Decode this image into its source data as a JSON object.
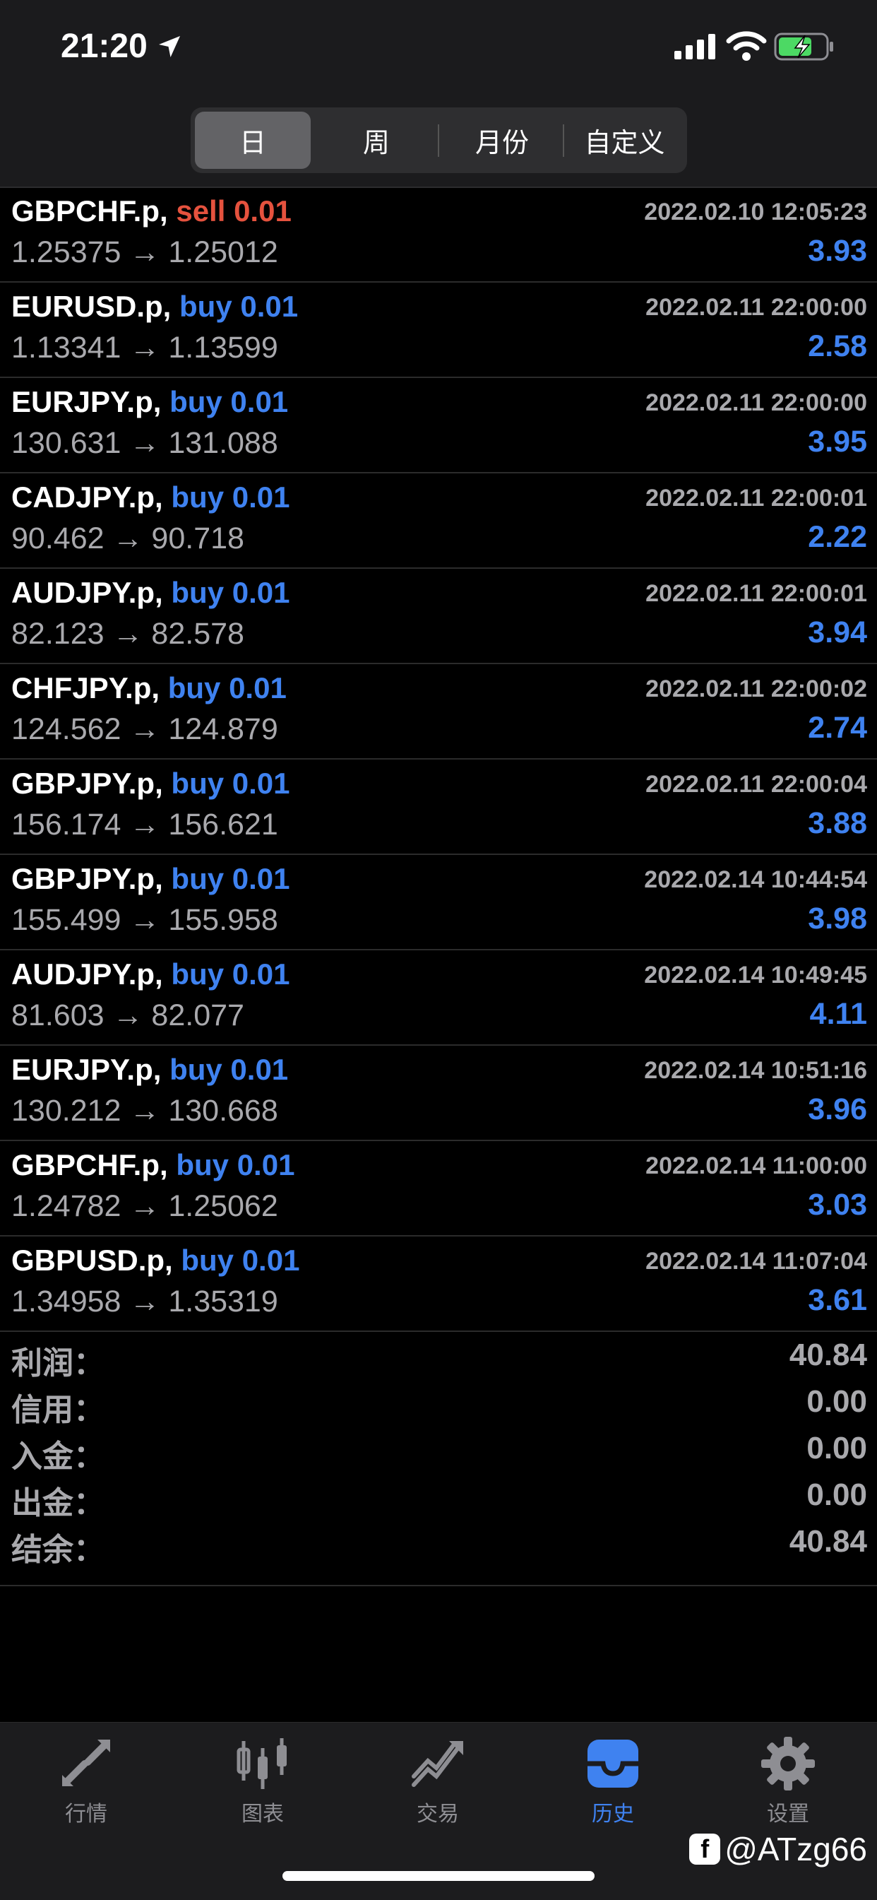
{
  "status": {
    "time": "21:20"
  },
  "segments": [
    {
      "label": "日",
      "active": true
    },
    {
      "label": "周",
      "active": false
    },
    {
      "label": "月份",
      "active": false
    },
    {
      "label": "自定义",
      "active": false
    }
  ],
  "trades": [
    {
      "symbol": "GBPCHF.p,",
      "side": "sell",
      "volume": "0.01",
      "time": "2022.02.10 12:05:23",
      "prices": "1.25375 → 1.25012",
      "profit": "3.93"
    },
    {
      "symbol": "EURUSD.p,",
      "side": "buy",
      "volume": "0.01",
      "time": "2022.02.11 22:00:00",
      "prices": "1.13341 → 1.13599",
      "profit": "2.58"
    },
    {
      "symbol": "EURJPY.p,",
      "side": "buy",
      "volume": "0.01",
      "time": "2022.02.11 22:00:00",
      "prices": "130.631 → 131.088",
      "profit": "3.95"
    },
    {
      "symbol": "CADJPY.p,",
      "side": "buy",
      "volume": "0.01",
      "time": "2022.02.11 22:00:01",
      "prices": "90.462 → 90.718",
      "profit": "2.22"
    },
    {
      "symbol": "AUDJPY.p,",
      "side": "buy",
      "volume": "0.01",
      "time": "2022.02.11 22:00:01",
      "prices": "82.123 → 82.578",
      "profit": "3.94"
    },
    {
      "symbol": "CHFJPY.p,",
      "side": "buy",
      "volume": "0.01",
      "time": "2022.02.11 22:00:02",
      "prices": "124.562 → 124.879",
      "profit": "2.74"
    },
    {
      "symbol": "GBPJPY.p,",
      "side": "buy",
      "volume": "0.01",
      "time": "2022.02.11 22:00:04",
      "prices": "156.174 → 156.621",
      "profit": "3.88"
    },
    {
      "symbol": "GBPJPY.p,",
      "side": "buy",
      "volume": "0.01",
      "time": "2022.02.14 10:44:54",
      "prices": "155.499 → 155.958",
      "profit": "3.98"
    },
    {
      "symbol": "AUDJPY.p,",
      "side": "buy",
      "volume": "0.01",
      "time": "2022.02.14 10:49:45",
      "prices": "81.603 → 82.077",
      "profit": "4.11"
    },
    {
      "symbol": "EURJPY.p,",
      "side": "buy",
      "volume": "0.01",
      "time": "2022.02.14 10:51:16",
      "prices": "130.212 → 130.668",
      "profit": "3.96"
    },
    {
      "symbol": "GBPCHF.p,",
      "side": "buy",
      "volume": "0.01",
      "time": "2022.02.14 11:00:00",
      "prices": "1.24782 → 1.25062",
      "profit": "3.03"
    },
    {
      "symbol": "GBPUSD.p,",
      "side": "buy",
      "volume": "0.01",
      "time": "2022.02.14 11:07:04",
      "prices": "1.34958 → 1.35319",
      "profit": "3.61"
    }
  ],
  "summary": [
    {
      "label": "利润：",
      "value": "40.84"
    },
    {
      "label": "信用：",
      "value": "0.00"
    },
    {
      "label": "入金：",
      "value": "0.00"
    },
    {
      "label": "出金：",
      "value": "0.00"
    },
    {
      "label": "结余：",
      "value": "40.84"
    }
  ],
  "tabs": [
    {
      "label": "行情",
      "icon": "quotes-arrows-icon",
      "active": false
    },
    {
      "label": "图表",
      "icon": "candlestick-chart-icon",
      "active": false
    },
    {
      "label": "交易",
      "icon": "trade-chart-icon",
      "active": false
    },
    {
      "label": "历史",
      "icon": "history-inbox-icon",
      "active": true
    },
    {
      "label": "设置",
      "icon": "gear-icon",
      "active": false
    }
  ],
  "watermark": "@ATzg66",
  "colors": {
    "buy": "#3f82f0",
    "sell": "#e5523e",
    "active_tab": "#3f82f0",
    "inactive_tab": "#8e8e93"
  }
}
